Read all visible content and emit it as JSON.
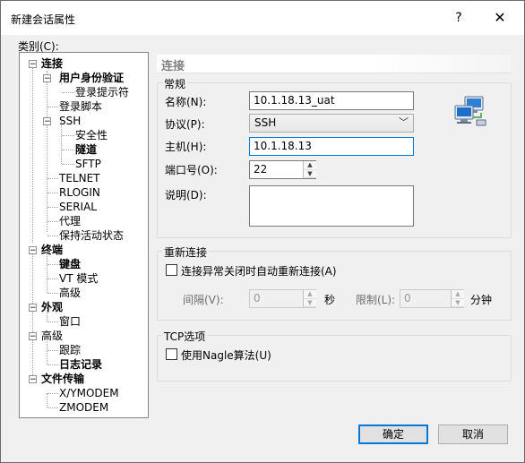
{
  "window": {
    "title": "新建会话属性",
    "help": "?",
    "close": "✕"
  },
  "category_label": "类别(C):",
  "tree": {
    "connection": "连接",
    "auth": "用户身份验证",
    "login_prompt": "登录提示符",
    "login_script": "登录脚本",
    "ssh": "SSH",
    "security": "安全性",
    "tunnel": "隧道",
    "sftp": "SFTP",
    "telnet": "TELNET",
    "rlogin": "RLOGIN",
    "serial": "SERIAL",
    "proxy": "代理",
    "keepalive": "保持活动状态",
    "terminal": "终端",
    "keyboard": "键盘",
    "vt_mode": "VT 模式",
    "advanced1": "高级",
    "appearance": "外观",
    "window": "窗口",
    "advanced": "高级",
    "trace": "跟踪",
    "logging": "日志记录",
    "file_transfer": "文件传输",
    "xymodem": "X/YMODEM",
    "zmodem": "ZMODEM",
    "expander_minus": "−"
  },
  "section_title": "连接",
  "general": {
    "group_title": "常规",
    "name_label": "名称(N):",
    "name_value": "10.1.18.13_uat",
    "protocol_label": "协议(P):",
    "protocol_value": "SSH",
    "host_label": "主机(H):",
    "host_value": "10.1.18.13",
    "port_label": "端口号(O):",
    "port_value": "22",
    "desc_label": "说明(D):",
    "desc_value": ""
  },
  "reconnect": {
    "group_title": "重新连接",
    "auto_label": "连接异常关闭时自动重新连接(A)",
    "auto_checked": false,
    "interval_label": "间隔(V):",
    "interval_value": "0",
    "interval_unit": "秒",
    "limit_label": "限制(L):",
    "limit_value": "0",
    "limit_unit": "分钟"
  },
  "tcp": {
    "group_title": "TCP选项",
    "nagle_label": "使用Nagle算法(U)",
    "nagle_checked": false
  },
  "buttons": {
    "ok": "确定",
    "cancel": "取消"
  },
  "spin": {
    "up": "▲",
    "down": "▼"
  },
  "dropdown_arrow": "﹀",
  "colors": {
    "accent": "#0078d7",
    "window_bg": "#f0f0f0"
  }
}
